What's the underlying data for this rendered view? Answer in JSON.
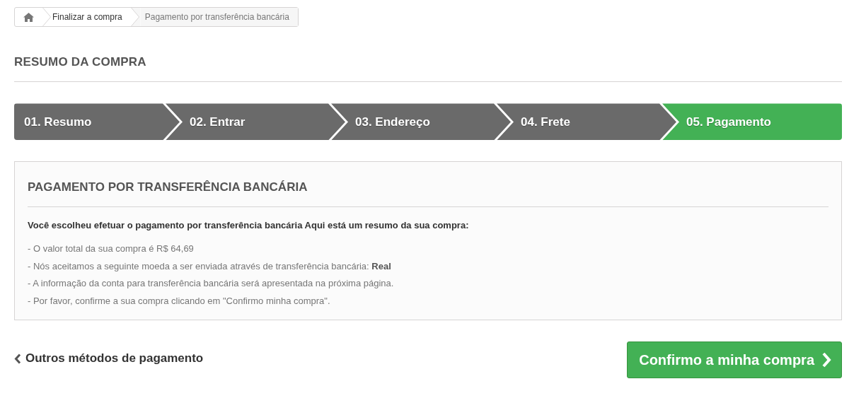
{
  "breadcrumb": [
    {
      "label": "Finalizar a compra",
      "selected": false
    },
    {
      "label": "Pagamento por transferência bancária",
      "selected": true
    }
  ],
  "page_title": "RESUMO DA COMPRA",
  "steps": [
    {
      "label": "01. Resumo",
      "selected": false
    },
    {
      "label": "02. Entrar",
      "selected": false
    },
    {
      "label": "03. Endereço",
      "selected": false
    },
    {
      "label": "04. Frete",
      "selected": false
    },
    {
      "label": "05. Pagamento",
      "selected": true
    }
  ],
  "panel": {
    "title": "PAGAMENTO POR TRANSFERÊNCIA BANCÁRIA",
    "intro": "Você escolheu efetuar o pagamento por transferência bancária Aqui está um resumo da sua compra:",
    "lines": [
      "- O valor total da sua compra é R$ 64,69",
      "- Nós aceitamos a seguinte moeda a ser enviada através de transferência bancária: **Real**",
      "- A informação da conta para transferência bancária será apresentada na próxima página.",
      "- Por favor, confirme a sua compra clicando em \"Confirmo minha compra\"."
    ]
  },
  "back_link": "Outros métodos de pagamento",
  "confirm_button": "Confirmo a minha compra"
}
